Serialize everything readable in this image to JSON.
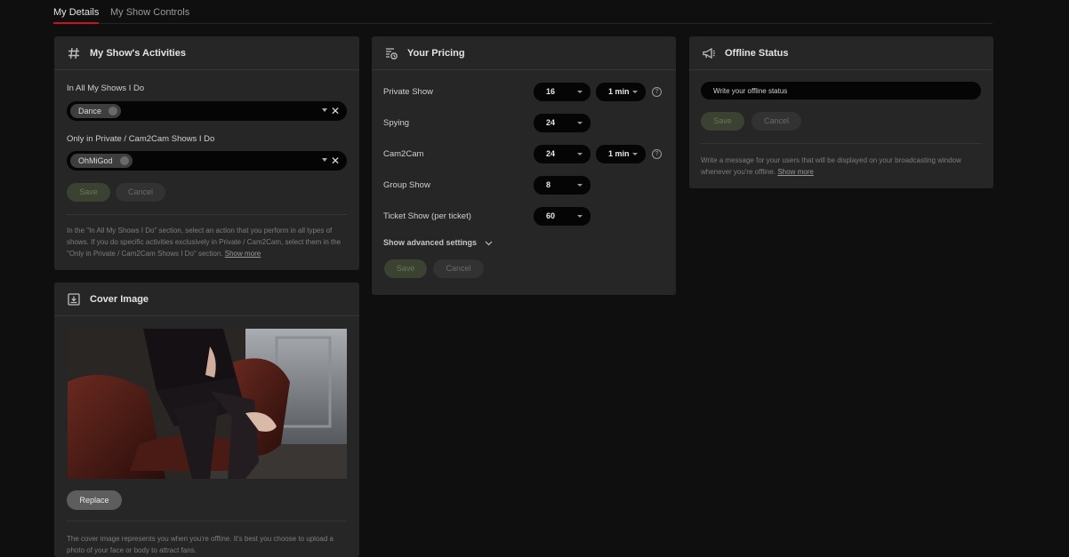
{
  "tabs": [
    {
      "label": "My Details",
      "active": true
    },
    {
      "label": "My Show Controls",
      "active": false
    }
  ],
  "activities": {
    "title": "My Show's Activities",
    "all_shows_label": "In All My Shows I Do",
    "all_shows_chip": "Dance",
    "private_label": "Only in Private / Cam2Cam Shows I Do",
    "private_chip": "OhMiGod",
    "clear_symbol": "✕",
    "save_label": "Save",
    "cancel_label": "Cancel",
    "help_text": "In the \"In All My Shows I Do\" section, select an action that you perform in all types of shows. If you do specific activities exclusively in Private / Cam2Cam, select them in the \"Only in Private / Cam2Cam Shows I Do\" section.",
    "show_more": "Show more"
  },
  "pricing": {
    "title": "Your Pricing",
    "rows": [
      {
        "label": "Private Show",
        "price": "16",
        "duration": "1 min",
        "help": "?"
      },
      {
        "label": "Spying",
        "price": "24"
      },
      {
        "label": "Cam2Cam",
        "price": "24",
        "duration": "1 min",
        "help": "?"
      },
      {
        "label": "Group Show",
        "price": "8"
      },
      {
        "label": "Ticket Show (per ticket)",
        "price": "60"
      }
    ],
    "advanced_label": "Show advanced settings",
    "save_label": "Save",
    "cancel_label": "Cancel"
  },
  "offline": {
    "title": "Offline Status",
    "placeholder": "Write your offline status",
    "save_label": "Save",
    "cancel_label": "Cancel",
    "help_text": "Write a message for your users that will be displayed on your broadcasting window whenever you're offline.",
    "show_more": "Show more"
  },
  "cover": {
    "title": "Cover Image",
    "replace_label": "Replace",
    "help_text": "The cover image represents you when you're offline. It's best you choose to upload a photo of your face or body to attract fans."
  },
  "colors": {
    "accent": "#c9121b",
    "card": "#262626",
    "background": "#0f0f0f"
  }
}
